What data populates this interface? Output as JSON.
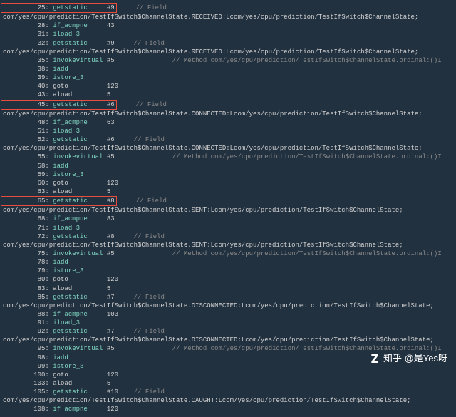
{
  "watermark": "知乎 @是Yes呀",
  "classpath_received": "com/yes/cpu/prediction/TestIfSwitch$ChannelState.RECEIVED:Lcom/yes/cpu/prediction/TestIfSwitch$ChannelState;",
  "classpath_connected": "com/yes/cpu/prediction/TestIfSwitch$ChannelState.CONNECTED:Lcom/yes/cpu/prediction/TestIfSwitch$ChannelState;",
  "classpath_sent": "com/yes/cpu/prediction/TestIfSwitch$ChannelState.SENT:Lcom/yes/cpu/prediction/TestIfSwitch$ChannelState;",
  "classpath_disconnected": "com/yes/cpu/prediction/TestIfSwitch$ChannelState.DISCONNECTED:Lcom/yes/cpu/prediction/TestIfSwitch$ChannelState;",
  "classpath_caught": "com/yes/cpu/prediction/TestIfSwitch$ChannelState.CAUGHT:Lcom/yes/cpu/prediction/TestIfSwitch$ChannelState;",
  "method_comment": "// Method com/yes/cpu/prediction/TestIfSwitch$ChannelState.ordinal:()I",
  "field_comment": "// Field",
  "lines": {
    "l25": {
      "off": "25:",
      "in": "getstatic",
      "arg": "#9",
      "hl": true
    },
    "l28": {
      "off": "28:",
      "in": "if_acmpne",
      "arg": "43"
    },
    "l31": {
      "off": "31:",
      "in": "iload_3",
      "arg": ""
    },
    "l32": {
      "off": "32:",
      "in": "getstatic",
      "arg": "#9"
    },
    "l35": {
      "off": "35:",
      "in": "invokevirtual",
      "arg": "#5"
    },
    "l38": {
      "off": "38:",
      "in": "iadd",
      "arg": ""
    },
    "l39": {
      "off": "39:",
      "in": "istore_3",
      "arg": ""
    },
    "l40": {
      "off": "40:",
      "in": "goto",
      "arg": "120"
    },
    "l43": {
      "off": "43:",
      "in": "aload",
      "arg": "5"
    },
    "l45": {
      "off": "45:",
      "in": "getstatic",
      "arg": "#6",
      "hl": true
    },
    "l48": {
      "off": "48:",
      "in": "if_acmpne",
      "arg": "63"
    },
    "l51": {
      "off": "51:",
      "in": "iload_3",
      "arg": ""
    },
    "l52": {
      "off": "52:",
      "in": "getstatic",
      "arg": "#6"
    },
    "l55": {
      "off": "55:",
      "in": "invokevirtual",
      "arg": "#5"
    },
    "l58": {
      "off": "58:",
      "in": "iadd",
      "arg": ""
    },
    "l59": {
      "off": "59:",
      "in": "istore_3",
      "arg": ""
    },
    "l60": {
      "off": "60:",
      "in": "goto",
      "arg": "120"
    },
    "l63": {
      "off": "63:",
      "in": "aload",
      "arg": "5"
    },
    "l65": {
      "off": "65:",
      "in": "getstatic",
      "arg": "#8",
      "hl": true
    },
    "l68": {
      "off": "68:",
      "in": "if_acmpne",
      "arg": "83"
    },
    "l71": {
      "off": "71:",
      "in": "iload_3",
      "arg": ""
    },
    "l72": {
      "off": "72:",
      "in": "getstatic",
      "arg": "#8"
    },
    "l75": {
      "off": "75:",
      "in": "invokevirtual",
      "arg": "#5"
    },
    "l78": {
      "off": "78:",
      "in": "iadd",
      "arg": ""
    },
    "l79": {
      "off": "79:",
      "in": "istore_3",
      "arg": ""
    },
    "l80": {
      "off": "80:",
      "in": "goto",
      "arg": "120"
    },
    "l83": {
      "off": "83:",
      "in": "aload",
      "arg": "5"
    },
    "l85": {
      "off": "85:",
      "in": "getstatic",
      "arg": "#7"
    },
    "l88": {
      "off": "88:",
      "in": "if_acmpne",
      "arg": "103"
    },
    "l91": {
      "off": "91:",
      "in": "iload_3",
      "arg": ""
    },
    "l92": {
      "off": "92:",
      "in": "getstatic",
      "arg": "#7"
    },
    "l95": {
      "off": "95:",
      "in": "invokevirtual",
      "arg": "#5"
    },
    "l98": {
      "off": "98:",
      "in": "iadd",
      "arg": ""
    },
    "l99": {
      "off": "99:",
      "in": "istore_3",
      "arg": ""
    },
    "l100": {
      "off": "100:",
      "in": "goto",
      "arg": "120"
    },
    "l103": {
      "off": "103:",
      "in": "aload",
      "arg": "5"
    },
    "l105": {
      "off": "105:",
      "in": "getstatic",
      "arg": "#10"
    },
    "l108": {
      "off": "108:",
      "in": "if_acmpne",
      "arg": "120"
    }
  }
}
